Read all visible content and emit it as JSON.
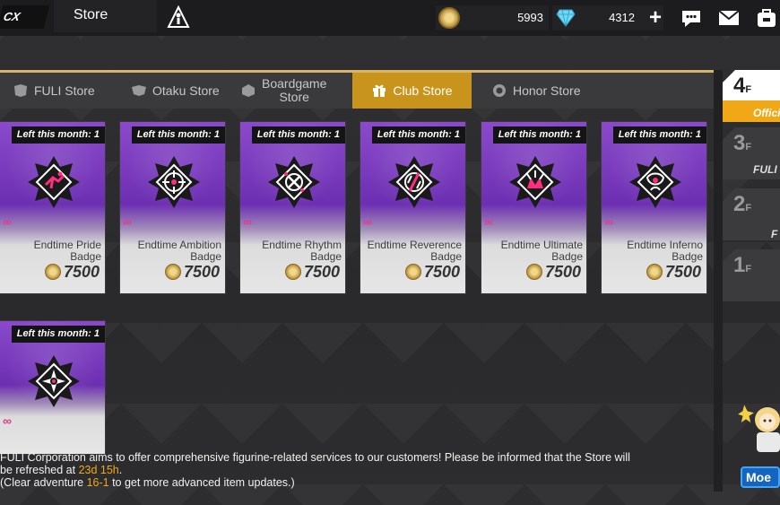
{
  "app": {
    "logo_text": "CX",
    "page_title": "Store"
  },
  "currency": {
    "gold": {
      "icon": "coin-icon",
      "value": "5993"
    },
    "gems": {
      "icon": "diamond-icon",
      "value": "4312",
      "add_label": "+"
    }
  },
  "top_icons": [
    "chat-icon",
    "mail-icon",
    "backpack-icon"
  ],
  "tabs": [
    {
      "label": "FULI Store",
      "icon": "fuli-store-icon",
      "active": false
    },
    {
      "label": "Otaku Store",
      "icon": "otaku-store-icon",
      "active": false
    },
    {
      "label": "Boardgame Store",
      "label_line1": "Boardgame",
      "label_line2": "Store",
      "icon": "boardgame-store-icon",
      "active": false
    },
    {
      "label": "Club Store",
      "icon": "gift-icon",
      "active": true
    },
    {
      "label": "Honor Store",
      "icon": "honor-store-icon",
      "active": false
    }
  ],
  "items": [
    {
      "limit": "Left this month: 1",
      "name": "Endtime Pride Badge",
      "price": "7500",
      "badge_icon": "pride-badge-icon",
      "accent": "#ff2e7e"
    },
    {
      "limit": "Left this month: 1",
      "name": "Endtime Ambition Badge",
      "price": "7500",
      "badge_icon": "ambition-badge-icon",
      "accent": "#ff2e7e"
    },
    {
      "limit": "Left this month: 1",
      "name": "Endtime Rhythm Badge",
      "price": "7500",
      "badge_icon": "rhythm-badge-icon",
      "accent": "#ff2e7e"
    },
    {
      "limit": "Left this month: 1",
      "name": "Endtime Reverence Badge",
      "price": "7500",
      "badge_icon": "reverence-badge-icon",
      "accent": "#ff2e7e"
    },
    {
      "limit": "Left this month: 1",
      "name": "Endtime Ultimate Badge",
      "price": "7500",
      "badge_icon": "ultimate-badge-icon",
      "accent": "#ff2e7e"
    },
    {
      "limit": "Left this month: 1",
      "name": "Endtime Inferno Badge",
      "price": "7500",
      "badge_icon": "inferno-badge-icon",
      "accent": "#ff2e7e"
    },
    {
      "limit": "Left this month: 1",
      "name": "",
      "price": "",
      "badge_icon": "web-badge-icon",
      "accent": "#ff2e7e"
    }
  ],
  "floors": [
    {
      "num": "4",
      "suffix": "F",
      "label": "Offici",
      "active": true
    },
    {
      "num": "3",
      "suffix": "F",
      "label": "FULI",
      "active": false
    },
    {
      "num": "2",
      "suffix": "F",
      "label": "F",
      "active": false
    },
    {
      "num": "1",
      "suffix": "F",
      "label": "",
      "active": false
    }
  ],
  "moe_button": "Moe",
  "info": {
    "line1": "FULI Corporation aims to offer comprehensive figurine-related services to our customers! Please be informed that the Store will",
    "line2_prefix": "be refreshed at ",
    "refresh_time": "23d 15h",
    "line2_suffix": ".",
    "line3_prefix": "(Clear adventure ",
    "stage": "16-1",
    "line3_suffix": " to get more advanced item updates.)"
  },
  "colors": {
    "accent_gold": "#c8941c",
    "purple": "#7a3bbf",
    "highlight": "#f0a817",
    "infinity_pink": "#e23b8c"
  }
}
